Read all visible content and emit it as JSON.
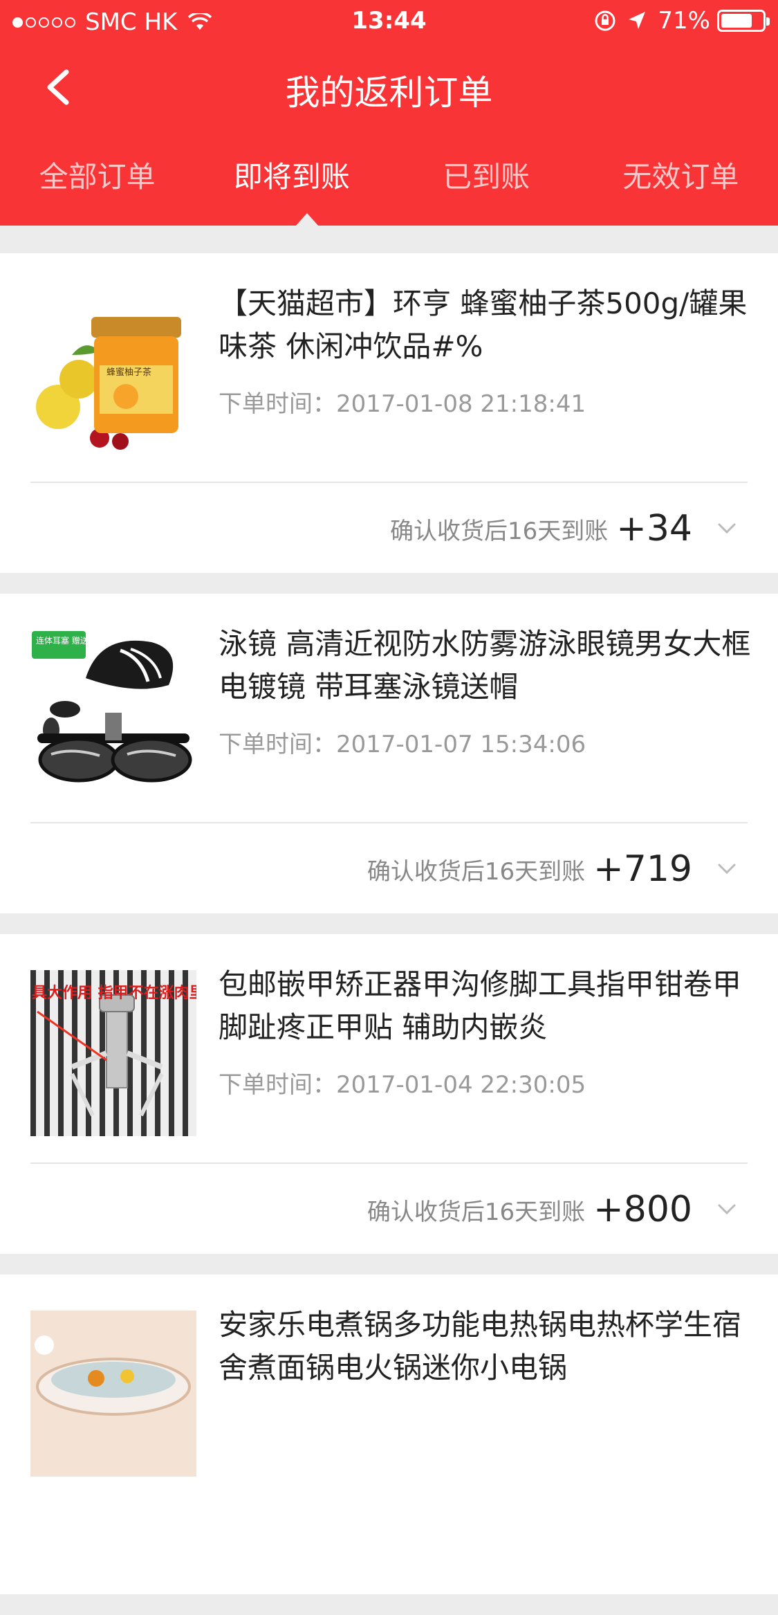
{
  "status_bar": {
    "carrier": "SMC HK",
    "time": "13:44",
    "battery": "71%"
  },
  "nav": {
    "title": "我的返利订单"
  },
  "tabs": [
    {
      "label": "全部订单"
    },
    {
      "label": "即将到账",
      "active": true
    },
    {
      "label": "已到账"
    },
    {
      "label": "无效订单"
    }
  ],
  "orders": [
    {
      "name": "【天猫超市】环亨 蜂蜜柚子茶500g/罐果味茶 休闲冲饮品#%",
      "time": "下单时间：2017-01-08 21:18:41",
      "note": "确认收货后16天到账",
      "amount": "+34",
      "image_label": "蜂蜜柚子茶"
    },
    {
      "name": "泳镜 高清近视防水防雾游泳眼镜男女大框电镀镜 带耳塞泳镜送帽",
      "time": "下单时间：2017-01-07 15:34:06",
      "note": "确认收货后16天到账",
      "amount": "+719",
      "image_label": "连体耳塞 赠送泳帽"
    },
    {
      "name": "包邮嵌甲矫正器甲沟修脚工具指甲钳卷甲脚趾疼正甲贴 辅助内嵌炎",
      "time": "下单时间：2017-01-04 22:30:05",
      "note": "确认收货后16天到账",
      "amount": "+800",
      "image_label": "具大作用 指甲不在涨肉里"
    },
    {
      "name": "安家乐电煮锅多功能电热锅电热杯学生宿舍煮面锅电火锅迷你小电锅",
      "time": "",
      "note": "",
      "amount": "",
      "image_label": ""
    }
  ],
  "colors": {
    "brand_red": "#f83437",
    "background": "#ececec"
  }
}
